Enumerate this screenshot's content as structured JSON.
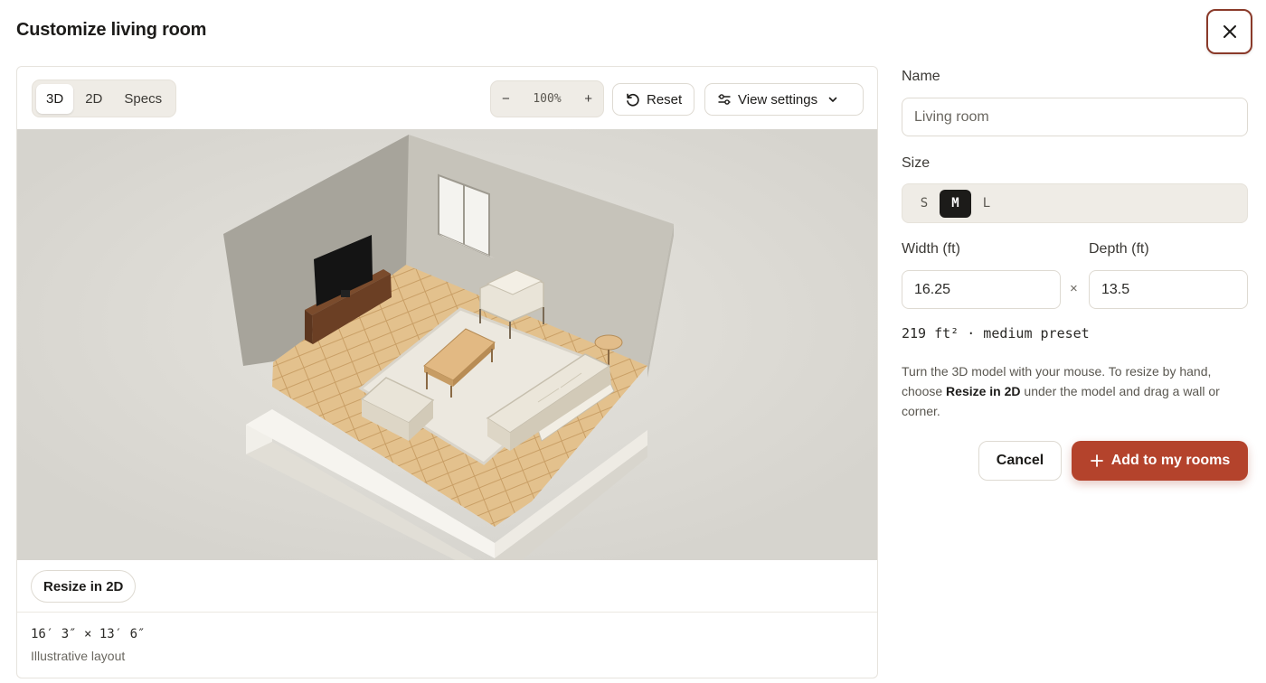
{
  "dialog": {
    "title": "Customize living room",
    "close_icon": "close-icon"
  },
  "viewer": {
    "tabs": [
      {
        "label": "3D",
        "active": true
      },
      {
        "label": "2D",
        "active": false
      },
      {
        "label": "Specs",
        "active": false
      }
    ],
    "zoom": {
      "minus": "−",
      "value": "100%",
      "plus": "+"
    },
    "reset_label": "Reset",
    "view_settings_label": "View settings",
    "resize_label": "Resize in 2D",
    "dimensions_text": "16′ 3″ × 13′ 6″",
    "dimensions_caption": "Illustrative layout"
  },
  "form": {
    "name_label": "Name",
    "name_placeholder": "Living room",
    "size_label": "Size",
    "sizes": [
      {
        "label": "S",
        "active": false
      },
      {
        "label": "M",
        "active": true
      },
      {
        "label": "L",
        "active": false
      }
    ],
    "width_label": "Width (ft)",
    "width_value": "16.25",
    "times_symbol": "×",
    "depth_label": "Depth (ft)",
    "depth_value": "13.5",
    "summary": "219 ft² · medium preset",
    "help_part1": "Turn the 3D model with your mouse. To resize by hand, choose ",
    "help_bold": "Resize in 2D",
    "help_part2": " under the model and drag a wall or corner.",
    "cancel_label": "Cancel",
    "add_label": "Add to my rooms"
  },
  "colors": {
    "accent": "#b4432c",
    "close_border": "#8a3a2a",
    "segment_bg": "#efece6",
    "floor": "#e2c08c",
    "wall": "#a8a59c"
  }
}
